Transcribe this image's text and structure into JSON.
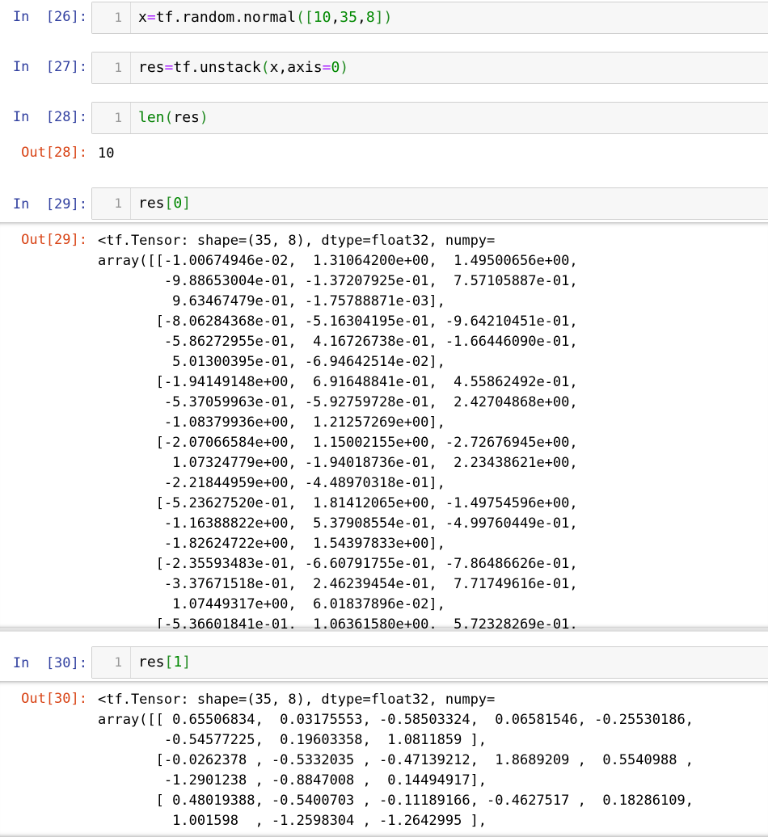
{
  "cells": [
    {
      "in_prompt": "In  [26]:",
      "line_no": "1",
      "code": "x=tf.random.normal([10,35,8])"
    },
    {
      "in_prompt": "In  [27]:",
      "line_no": "1",
      "code": "res=tf.unstack(x,axis=0)"
    },
    {
      "in_prompt": "In  [28]:",
      "line_no": "1",
      "code": "len(res)",
      "out_prompt": "Out[28]:",
      "output": "10"
    },
    {
      "in_prompt": "In  [29]:",
      "line_no": "1",
      "code": "res[0]",
      "out_prompt": "Out[29]:",
      "output": "<tf.Tensor: shape=(35, 8), dtype=float32, numpy=\narray([[-1.00674946e-02,  1.31064200e+00,  1.49500656e+00,\n        -9.88653004e-01, -1.37207925e-01,  7.57105887e-01,\n         9.63467479e-01, -1.75788871e-03],\n       [-8.06284368e-01, -5.16304195e-01, -9.64210451e-01,\n        -5.86272955e-01,  4.16726738e-01, -1.66446090e-01,\n         5.01300395e-01, -6.94642514e-02],\n       [-1.94149148e+00,  6.91648841e-01,  4.55862492e-01,\n        -5.37059963e-01, -5.92759728e-01,  2.42704868e+00,\n        -1.08379936e+00,  1.21257269e+00],\n       [-2.07066584e+00,  1.15002155e+00, -2.72676945e+00,\n         1.07324779e+00, -1.94018736e-01,  2.23438621e+00,\n        -2.21844959e+00, -4.48970318e-01],\n       [-5.23627520e-01,  1.81412065e+00, -1.49754596e+00,\n        -1.16388822e+00,  5.37908554e-01, -4.99760449e-01,\n        -1.82624722e+00,  1.54397833e+00],\n       [-2.35593483e-01, -6.60791755e-01, -7.86486626e-01,\n        -3.37671518e-01,  2.46239454e-01,  7.71749616e-01,\n         1.07449317e+00,  6.01837896e-02],\n       [-5.36601841e-01,  1.06361580e+00,  5.72328269e-01,"
    },
    {
      "in_prompt": "In  [30]:",
      "line_no": "1",
      "code": "res[1]",
      "out_prompt": "Out[30]:",
      "output": "<tf.Tensor: shape=(35, 8), dtype=float32, numpy=\narray([[ 0.65506834,  0.03175553, -0.58503324,  0.06581546, -0.25530186,\n        -0.54577225,  0.19603358,  1.0811859 ],\n       [-0.0262378 , -0.5332035 , -0.47139212,  1.8689209 ,  0.5540988 ,\n        -1.2901238 , -0.8847008 ,  0.14494917],\n       [ 0.48019388, -0.5400703 , -0.11189166, -0.4627517 ,  0.18286109,\n         1.001598  , -1.2598304 , -1.2642995 ],"
    }
  ]
}
